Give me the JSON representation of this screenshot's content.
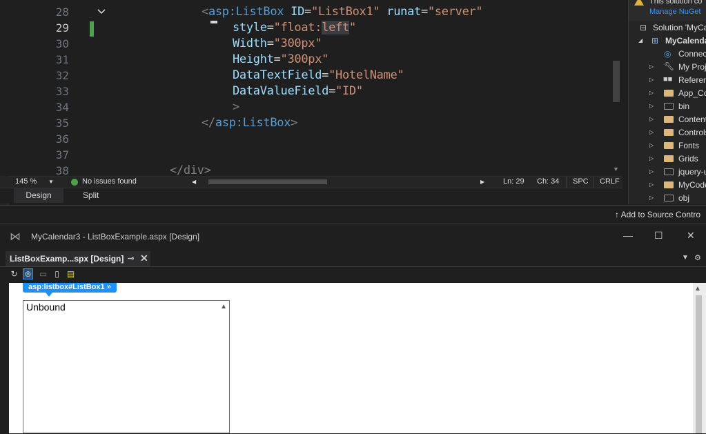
{
  "editor": {
    "line_numbers": [
      "28",
      "29",
      "30",
      "31",
      "32",
      "33",
      "34",
      "35",
      "36",
      "37",
      "38"
    ],
    "active_line": "29",
    "lines": {
      "l28": {
        "open": "<",
        "tag": "asp:ListBox",
        "a1": " ID",
        "e1": "=",
        "v1": "\"ListBox1\"",
        "a2": " runat",
        "e2": "=",
        "v2": "\"server\""
      },
      "l29": {
        "attr": "style",
        "eq": "=",
        "q": "\"float:",
        "sel": "left",
        "qe": "\""
      },
      "l30": {
        "attr": "Width",
        "eq": "=",
        "val": "\"300px\""
      },
      "l31": {
        "attr": "Height",
        "eq": "=",
        "val": "\"300px\""
      },
      "l32": {
        "attr": "DataTextField",
        "eq": "=",
        "val": "\"HotelName\""
      },
      "l33": {
        "attr": "DataValueField",
        "eq": "=",
        "val": "\"ID\""
      },
      "l34": {
        "close": ">"
      },
      "l35": {
        "open": "</",
        "tag": "asp:ListBox",
        "close": ">"
      },
      "l38": {
        "text": "</div>"
      }
    }
  },
  "statusbar": {
    "zoom": "145 %",
    "issues": "No issues found",
    "ln": "Ln: 29",
    "ch": "Ch: 34",
    "spc": "SPC",
    "crlf": "CRLF"
  },
  "view_tabs": {
    "design": "Design",
    "split": "Split"
  },
  "solution_explorer": {
    "banner_text": "This solution co",
    "banner_link": "Manage NuGet",
    "items": [
      {
        "label": "Solution 'MyCa",
        "icon": "solution-icon"
      },
      {
        "label": "MyCalenda",
        "icon": "web-project-icon"
      },
      {
        "label": "Connect",
        "icon": "connected-services-icon"
      },
      {
        "label": "My Proj",
        "icon": "wrench-icon"
      },
      {
        "label": "Referen",
        "icon": "references-icon"
      },
      {
        "label": "App_Co",
        "icon": "folder-icon"
      },
      {
        "label": "bin",
        "icon": "folder-icon"
      },
      {
        "label": "Content",
        "icon": "folder-icon"
      },
      {
        "label": "Controls",
        "icon": "folder-icon"
      },
      {
        "label": "Fonts",
        "icon": "folder-icon"
      },
      {
        "label": "Grids",
        "icon": "folder-icon"
      },
      {
        "label": "jquery-u",
        "icon": "folder-icon"
      },
      {
        "label": "MyCode",
        "icon": "folder-icon"
      },
      {
        "label": "obj",
        "icon": "folder-icon"
      }
    ]
  },
  "source_control": {
    "label": "Add to Source Contro"
  },
  "designer": {
    "window_title": "MyCalendar3 - ListBoxExample.aspx [Design]",
    "tab_label": "ListBoxExamp...spx [Design]",
    "selector_label": "asp:listbox#ListBox1",
    "selector_arrow": "»",
    "listbox_item": "Unbound"
  },
  "colors": {
    "accent": "#1e90ff",
    "ok": "#4ea34a",
    "folder": "#dcb67a"
  }
}
